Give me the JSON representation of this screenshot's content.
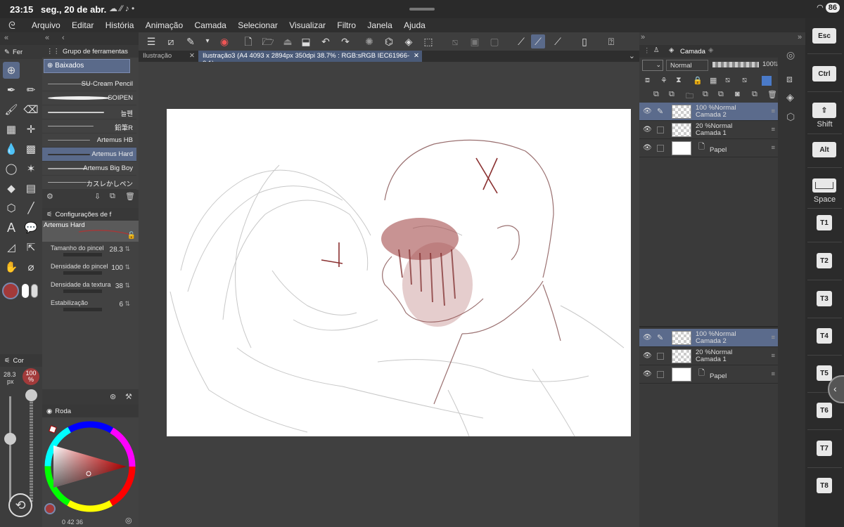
{
  "status": {
    "time": "23:15",
    "date": "seg., 20 de abr.",
    "battery": "86",
    "icons": "☁ ⁄⁄ ♪ •"
  },
  "menu": [
    "Arquivo",
    "Editar",
    "História",
    "Animação",
    "Camada",
    "Selecionar",
    "Visualizar",
    "Filtro",
    "Janela",
    "Ajuda"
  ],
  "tool_panel": {
    "tab": "Fer"
  },
  "subtool": {
    "title": "Grupo de ferramentas",
    "group": "Baixados",
    "brushes": [
      {
        "name": "SU-Cream Pencil",
        "selected": false
      },
      {
        "name": "SOIPEN",
        "selected": false
      },
      {
        "name": "늘펜",
        "selected": false
      },
      {
        "name": "鉛筆R",
        "selected": false
      },
      {
        "name": "Artemus HB",
        "selected": false
      },
      {
        "name": "Artemus Hard",
        "selected": true
      },
      {
        "name": "Artemus Big Boy",
        "selected": false
      },
      {
        "name": "カスレかしペン",
        "selected": false
      }
    ]
  },
  "settings": {
    "title": "Configurações de f",
    "brush_name": "Artemus Hard",
    "rows": [
      {
        "name": "Tamanho do pincel",
        "value": "28.3"
      },
      {
        "name": "Densidade do pincel",
        "value": "100"
      },
      {
        "name": "Densidade da textura",
        "value": "38"
      },
      {
        "name": "Estabilização",
        "value": "6"
      }
    ]
  },
  "left_bottom": {
    "tab": "Cor",
    "size": "28.3",
    "size_unit": "px",
    "opacity": "100",
    "opacity_unit": "%"
  },
  "color": {
    "title": "Roda",
    "footer": "0  42  36",
    "accent": "#a23a3a"
  },
  "tabs": [
    {
      "label": "Ilustração",
      "active": false
    },
    {
      "label": "Ilustração3 (A4 4093 x 2894px 350dpi 38.7% : RGB:sRGB IEC61966-2.1)",
      "active": true
    }
  ],
  "layers": {
    "title": "Camada",
    "blend": "Normal",
    "opacity": "100",
    "top_list": [
      {
        "l1": "100 %Normal",
        "l2": "Camada 2",
        "selected": true,
        "paper": false
      },
      {
        "l1": "20 %Normal",
        "l2": "Camada 1",
        "selected": false,
        "paper": false
      },
      {
        "l1": "",
        "l2": "Papel",
        "selected": false,
        "paper": true
      }
    ],
    "bottom_list": [
      {
        "l1": "100 %Normal",
        "l2": "Camada 2",
        "selected": true,
        "paper": false
      },
      {
        "l1": "20 %Normal",
        "l2": "Camada 1",
        "selected": false,
        "paper": false
      },
      {
        "l1": "",
        "l2": "Papel",
        "selected": false,
        "paper": true
      }
    ]
  },
  "keys": {
    "esc": "Esc",
    "ctrl": "Ctrl",
    "shift": "Shift",
    "alt": "Alt",
    "space": "Space",
    "t": [
      "T1",
      "T2",
      "T3",
      "T4",
      "T5",
      "T6",
      "T7",
      "T8"
    ]
  }
}
